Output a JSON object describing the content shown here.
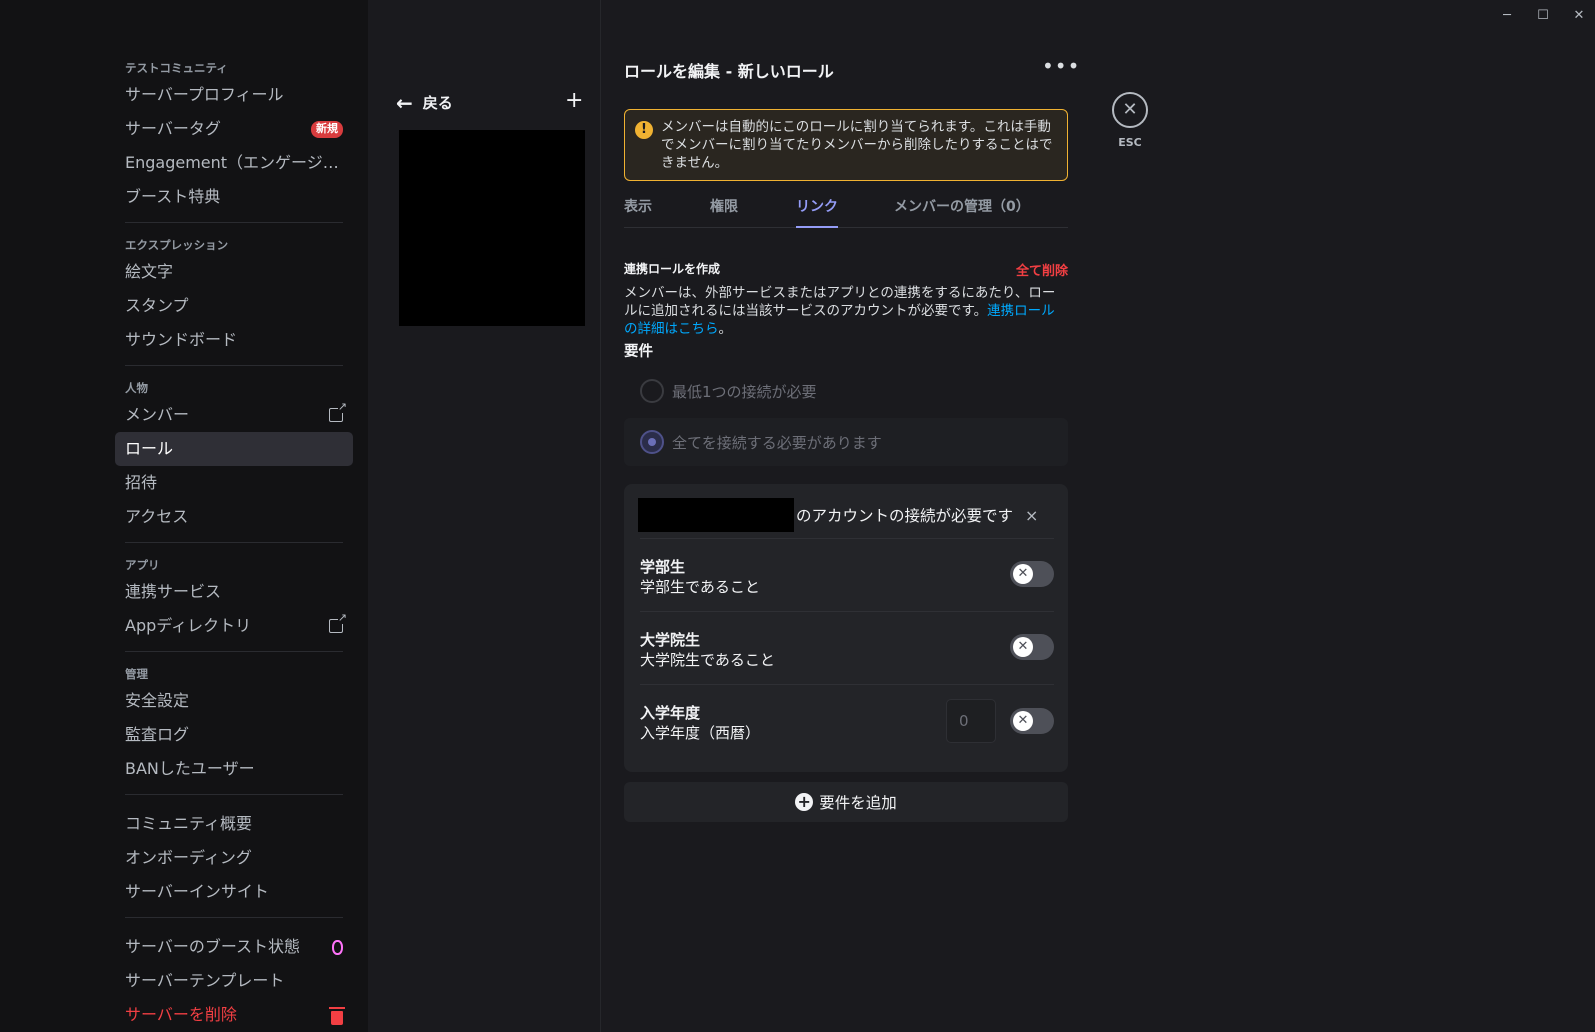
{
  "window": {
    "minimize": "─",
    "maximize": "☐",
    "close": "✕"
  },
  "sidebar": {
    "sections": [
      {
        "head": "テストコミュニティ",
        "items": [
          {
            "label": "サーバープロフィール"
          },
          {
            "label": "サーバータグ",
            "badge": "新規"
          },
          {
            "label": "Engagement（エンゲージメ..."
          },
          {
            "label": "ブースト特典"
          }
        ]
      },
      {
        "head": "エクスプレッション",
        "items": [
          {
            "label": "絵文字"
          },
          {
            "label": "スタンプ"
          },
          {
            "label": "サウンドボード"
          }
        ]
      },
      {
        "head": "人物",
        "items": [
          {
            "label": "メンバー"
          },
          {
            "label": "ロール"
          },
          {
            "label": "招待"
          },
          {
            "label": "アクセス"
          }
        ]
      },
      {
        "head": "アプリ",
        "items": [
          {
            "label": "連携サービス"
          },
          {
            "label": "Appディレクトリ"
          }
        ]
      },
      {
        "head": "管理",
        "items": [
          {
            "label": "安全設定"
          },
          {
            "label": "監査ログ"
          },
          {
            "label": "BANしたユーザー"
          }
        ]
      },
      {
        "head": "",
        "items": [
          {
            "label": "コミュニティ概要"
          },
          {
            "label": "オンボーディング"
          },
          {
            "label": "サーバーインサイト"
          }
        ]
      },
      {
        "head": "",
        "items": [
          {
            "label": "サーバーのブースト状態"
          },
          {
            "label": "サーバーテンプレート"
          },
          {
            "label": "サーバーを削除"
          }
        ]
      }
    ]
  },
  "rolelist": {
    "back_label": "戻る",
    "add_symbol": "+"
  },
  "main": {
    "title": "ロールを編集 - 新しいロール",
    "more_symbol": "•••",
    "warning": {
      "icon": "!",
      "text": "メンバーは自動的にこのロールに割り当てられます。これは手動でメンバーに割り当てたりメンバーから削除したりすることはできません。"
    },
    "tabs": [
      {
        "label": "表示"
      },
      {
        "label": "権限"
      },
      {
        "label": "リンク"
      },
      {
        "label": "メンバーの管理（0）"
      }
    ],
    "linked": {
      "heading": "連携ロールを作成",
      "delete_all": "全て削除",
      "desc_pre": "メンバーは、外部サービスまたはアプリとの連携をするにあたり、ロールに追加されるには当該サービスのアカウントが必要です。",
      "desc_link": "連携ロールの詳細はこちら",
      "desc_post": "。",
      "requirements_head": "要件",
      "radio_any": "最低1つの接続が必要",
      "radio_all": "全てを接続する必要があります",
      "conn_required": "のアカウントの接続が必要です",
      "remove_symbol": "×",
      "criteria": [
        {
          "name": "学部生",
          "desc": "学部生であること"
        },
        {
          "name": "大学院生",
          "desc": "大学院生であること"
        },
        {
          "name": "入学年度",
          "desc": " 入学年度（西暦）",
          "value": "0"
        }
      ],
      "toggle_symbol": "✕",
      "add_requirement": "要件を追加",
      "add_symbol": "+"
    }
  },
  "esc": {
    "symbol": "✕",
    "label": "ESC"
  }
}
